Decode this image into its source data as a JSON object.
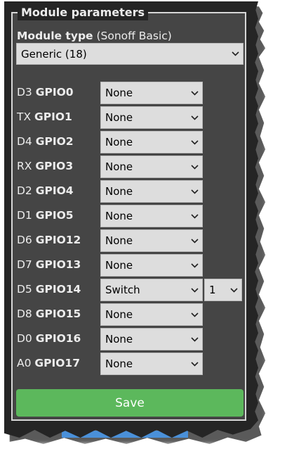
{
  "legend": "Module parameters",
  "module_type": {
    "label": "Module type",
    "current": "(Sonoff Basic)",
    "selected": "Generic (18)"
  },
  "gpios": [
    {
      "pin": "D3",
      "gpio": "GPIO0",
      "value": "None"
    },
    {
      "pin": "TX",
      "gpio": "GPIO1",
      "value": "None"
    },
    {
      "pin": "D4",
      "gpio": "GPIO2",
      "value": "None"
    },
    {
      "pin": "RX",
      "gpio": "GPIO3",
      "value": "None"
    },
    {
      "pin": "D2",
      "gpio": "GPIO4",
      "value": "None"
    },
    {
      "pin": "D1",
      "gpio": "GPIO5",
      "value": "None"
    },
    {
      "pin": "D6",
      "gpio": "GPIO12",
      "value": "None"
    },
    {
      "pin": "D7",
      "gpio": "GPIO13",
      "value": "None"
    },
    {
      "pin": "D5",
      "gpio": "GPIO14",
      "value": "Switch",
      "index": "1"
    },
    {
      "pin": "D8",
      "gpio": "GPIO15",
      "value": "None"
    },
    {
      "pin": "D0",
      "gpio": "GPIO16",
      "value": "None"
    },
    {
      "pin": "A0",
      "gpio": "GPIO17",
      "value": "None"
    }
  ],
  "save_label": "Save",
  "colors": {
    "panel_bg": "#454545",
    "page_bg": "#252525",
    "save_button": "#5cb85c",
    "select_bg": "#dddddd"
  }
}
